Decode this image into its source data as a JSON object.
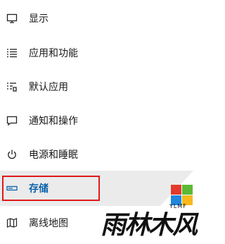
{
  "nav": {
    "items": [
      {
        "label": "显示",
        "icon": "display-icon"
      },
      {
        "label": "应用和功能",
        "icon": "apps-list-icon"
      },
      {
        "label": "默认应用",
        "icon": "default-apps-icon"
      },
      {
        "label": "通知和操作",
        "icon": "notification-icon"
      },
      {
        "label": "电源和睡眠",
        "icon": "power-icon"
      },
      {
        "label": "存储",
        "icon": "storage-drive-icon",
        "selected": true
      },
      {
        "label": "离线地图",
        "icon": "offline-map-icon"
      }
    ]
  },
  "colors": {
    "selected_text": "#0a62a8",
    "highlight_border": "#e01919",
    "selected_bg": "#ebebeb"
  },
  "watermark": {
    "brand": "雨林木风",
    "sub": "YLMF"
  }
}
